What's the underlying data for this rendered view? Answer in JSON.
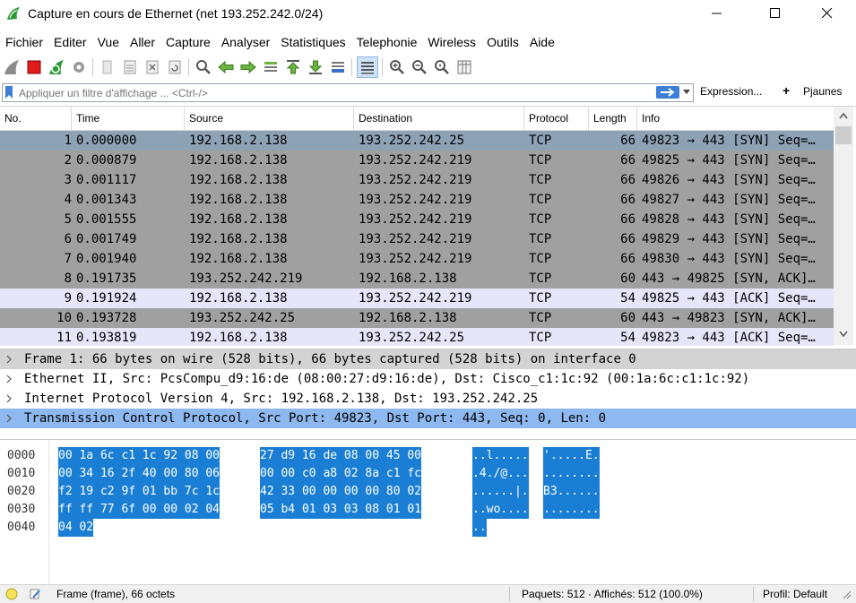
{
  "window": {
    "title": "Capture en cours de Ethernet (net 193.252.242.0/24)",
    "minimize_label": "—",
    "maximize_label": "☐",
    "close_label": "✕"
  },
  "menu": [
    "Fichier",
    "Editer",
    "Vue",
    "Aller",
    "Capture",
    "Analyser",
    "Statistiques",
    "Telephonie",
    "Wireless",
    "Outils",
    "Aide"
  ],
  "filter": {
    "placeholder": "Appliquer un filtre d'affichage ... <Ctrl-/>",
    "expression_label": "Expression...",
    "add_symbol": "+",
    "add_label": "Pjaunes"
  },
  "packet_list": {
    "columns": [
      "No.",
      "Time",
      "Source",
      "Destination",
      "Protocol",
      "Length",
      "Info"
    ],
    "rows": [
      {
        "no": "1",
        "time": "0.000000",
        "src": "192.168.2.138",
        "dst": "193.252.242.25",
        "proto": "TCP",
        "len": "66",
        "info": "49823 → 443 [SYN] Seq=…",
        "style": "sel"
      },
      {
        "no": "2",
        "time": "0.000879",
        "src": "192.168.2.138",
        "dst": "193.252.242.219",
        "proto": "TCP",
        "len": "66",
        "info": "49825 → 443 [SYN] Seq=…",
        "style": "grey"
      },
      {
        "no": "3",
        "time": "0.001117",
        "src": "192.168.2.138",
        "dst": "193.252.242.219",
        "proto": "TCP",
        "len": "66",
        "info": "49826 → 443 [SYN] Seq=…",
        "style": "grey"
      },
      {
        "no": "4",
        "time": "0.001343",
        "src": "192.168.2.138",
        "dst": "193.252.242.219",
        "proto": "TCP",
        "len": "66",
        "info": "49827 → 443 [SYN] Seq=…",
        "style": "grey"
      },
      {
        "no": "5",
        "time": "0.001555",
        "src": "192.168.2.138",
        "dst": "193.252.242.219",
        "proto": "TCP",
        "len": "66",
        "info": "49828 → 443 [SYN] Seq=…",
        "style": "grey"
      },
      {
        "no": "6",
        "time": "0.001749",
        "src": "192.168.2.138",
        "dst": "193.252.242.219",
        "proto": "TCP",
        "len": "66",
        "info": "49829 → 443 [SYN] Seq=…",
        "style": "grey"
      },
      {
        "no": "7",
        "time": "0.001940",
        "src": "192.168.2.138",
        "dst": "193.252.242.219",
        "proto": "TCP",
        "len": "66",
        "info": "49830 → 443 [SYN] Seq=…",
        "style": "grey"
      },
      {
        "no": "8",
        "time": "0.191735",
        "src": "193.252.242.219",
        "dst": "192.168.2.138",
        "proto": "TCP",
        "len": "60",
        "info": "443 → 49825 [SYN, ACK]…",
        "style": "grey"
      },
      {
        "no": "9",
        "time": "0.191924",
        "src": "192.168.2.138",
        "dst": "193.252.242.219",
        "proto": "TCP",
        "len": "54",
        "info": "49825 → 443 [ACK] Seq=…",
        "style": "light"
      },
      {
        "no": "10",
        "time": "0.193728",
        "src": "193.252.242.25",
        "dst": "192.168.2.138",
        "proto": "TCP",
        "len": "60",
        "info": "443 → 49823 [SYN, ACK]…",
        "style": "grey"
      },
      {
        "no": "11",
        "time": "0.193819",
        "src": "192.168.2.138",
        "dst": "193.252.242.25",
        "proto": "TCP",
        "len": "54",
        "info": "49823 → 443 [ACK] Seq=…",
        "style": "light"
      }
    ]
  },
  "details": [
    {
      "text": "Frame 1: 66 bytes on wire (528 bits), 66 bytes captured (528 bits) on interface 0",
      "style": "grey"
    },
    {
      "text": "Ethernet II, Src: PcsCompu_d9:16:de (08:00:27:d9:16:de), Dst: Cisco_c1:1c:92 (00:1a:6c:c1:1c:92)",
      "style": "plain"
    },
    {
      "text": "Internet Protocol Version 4, Src: 192.168.2.138, Dst: 193.252.242.25",
      "style": "plain"
    },
    {
      "text": "Transmission Control Protocol, Src Port: 49823, Dst Port: 443, Seq: 0, Len: 0",
      "style": "sel"
    }
  ],
  "hex": [
    {
      "offset": "0000",
      "hex1": "00 1a 6c c1 1c 92 08 00",
      "hex2": "27 d9 16 de 08 00 45 00",
      "ascii1": "..l.....",
      "ascii2": "'.....E."
    },
    {
      "offset": "0010",
      "hex1": "00 34 16 2f 40 00 80 06",
      "hex2": "00 00 c0 a8 02 8a c1 fc",
      "ascii1": ".4./@...",
      "ascii2": "........"
    },
    {
      "offset": "0020",
      "hex1": "f2 19 c2 9f 01 bb 7c 1c",
      "hex2": "42 33 00 00 00 00 80 02",
      "ascii1": "......|.",
      "ascii2": "B3......"
    },
    {
      "offset": "0030",
      "hex1": "ff ff 77 6f 00 00 02 04",
      "hex2": "05 b4 01 03 03 08 01 01",
      "ascii1": "..wo....",
      "ascii2": "........"
    },
    {
      "offset": "0040",
      "hex1": "04 02",
      "hex2": "",
      "ascii1": "..",
      "ascii2": ""
    }
  ],
  "status": {
    "frame_info": "Frame (frame), 66 octets",
    "packets": "Paquets: 512 · Affichés: 512 (100.0%)",
    "profile": "Profil: Default"
  },
  "colors": {
    "selected_row": "#8da2b5",
    "grey_row": "#a0a0a0",
    "light_row": "#e6e6fa",
    "detail_selected": "#8eb8f0",
    "hex_highlight": "#1a7fd4"
  }
}
